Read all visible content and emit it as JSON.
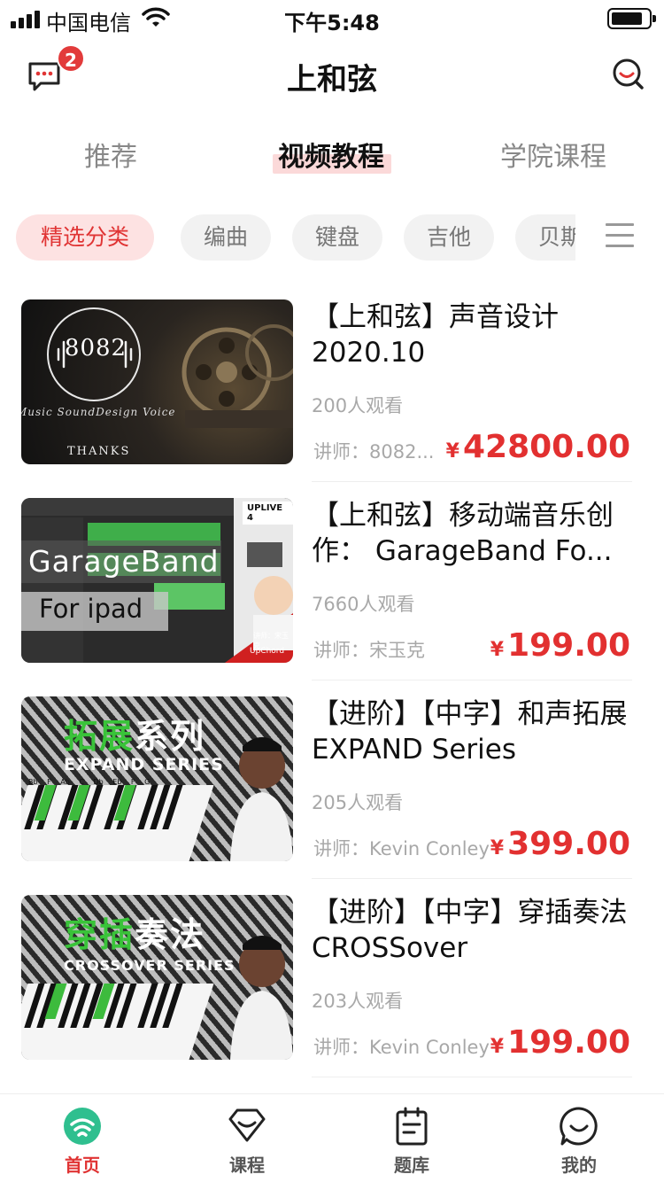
{
  "status_bar": {
    "carrier": "中国电信",
    "time": "下午5:48"
  },
  "nav": {
    "title": "上和弦",
    "message_badge": "2"
  },
  "tabs": [
    {
      "label": "推荐",
      "active": false
    },
    {
      "label": "视频教程",
      "active": true
    },
    {
      "label": "学院课程",
      "active": false
    }
  ],
  "chips": [
    {
      "label": "精选分类",
      "active": true
    },
    {
      "label": "编曲",
      "active": false
    },
    {
      "label": "键盘",
      "active": false
    },
    {
      "label": "吉他",
      "active": false
    },
    {
      "label": "贝斯",
      "active": false
    }
  ],
  "courses": [
    {
      "title": "【上和弦】声音设计 2020.10",
      "views": "200人观看",
      "teacher": "讲师：8082...",
      "currency": "¥",
      "price": "42800.00",
      "thumb": {
        "logo": "8082",
        "subtitle": "Music SoundDesign Voice",
        "footer": "THANKS"
      }
    },
    {
      "title": "【上和弦】移动端音乐创作： GarageBand Fo...",
      "views": "7660人观看",
      "teacher": "讲师：宋玉克",
      "currency": "¥",
      "price": "199.00",
      "thumb": {
        "line1": "GarageBand",
        "line2": "For ipad",
        "tag": "UPLIVE 4",
        "caption": "讲师：宋玉克",
        "brand": "UpChord"
      }
    },
    {
      "title": "【进阶】【中字】和声拓展 EXPAND Series",
      "views": "205人观看",
      "teacher": "讲师：Kevin Conley",
      "currency": "¥",
      "price": "399.00",
      "thumb": {
        "headline_a": "拓展",
        "headline_b": "系列",
        "series": "EXPAND SERIES",
        "chords": "Bb F Ab C Db Eb F G"
      }
    },
    {
      "title": "【进阶】【中字】穿插奏法 CROSSover",
      "views": "203人观看",
      "teacher": "讲师：Kevin Conley",
      "currency": "¥",
      "price": "199.00",
      "thumb": {
        "headline_a": "穿插",
        "headline_b": "奏法",
        "series": "CROSSOVER SERIES"
      }
    }
  ],
  "tabbar": [
    {
      "label": "首页",
      "icon": "home-icon",
      "active": true
    },
    {
      "label": "课程",
      "icon": "course-icon",
      "active": false
    },
    {
      "label": "题库",
      "icon": "question-bank-icon",
      "active": false
    },
    {
      "label": "我的",
      "icon": "profile-icon",
      "active": false
    }
  ],
  "colors": {
    "accent": "#e03434",
    "chip_active_bg": "#fde2e2",
    "tab_underline": "#fbd9d9"
  }
}
